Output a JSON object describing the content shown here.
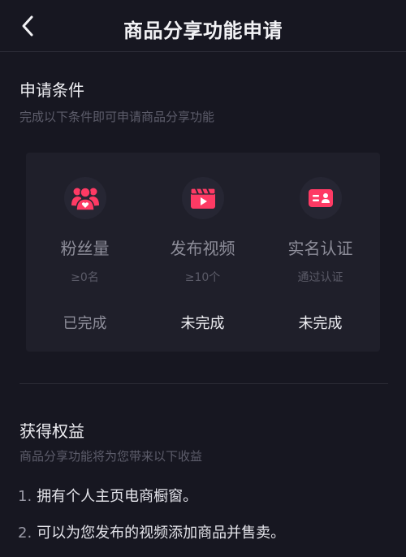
{
  "header": {
    "title": "商品分享功能申请",
    "back_icon": "chevron-left-icon"
  },
  "conditions": {
    "title": "申请条件",
    "subtitle": "完成以下条件即可申请商品分享功能",
    "items": [
      {
        "icon": "fans-icon",
        "label": "粉丝量",
        "requirement": "≥0名",
        "status": "已完成"
      },
      {
        "icon": "video-icon",
        "label": "发布视频",
        "requirement": "≥10个",
        "status": "未完成"
      },
      {
        "icon": "id-card-icon",
        "label": "实名认证",
        "requirement": "通过认证",
        "status": "未完成"
      }
    ]
  },
  "benefits": {
    "title": "获得权益",
    "subtitle": "商品分享功能将为您带来以下收益",
    "items": [
      {
        "num": "1.",
        "text": "拥有个人主页电商橱窗。"
      },
      {
        "num": "2.",
        "text": "可以为您发布的视频添加商品并售卖。"
      }
    ]
  },
  "colors": {
    "background": "#171721",
    "card": "#1f1f2a",
    "accent": "#fe3a64"
  }
}
